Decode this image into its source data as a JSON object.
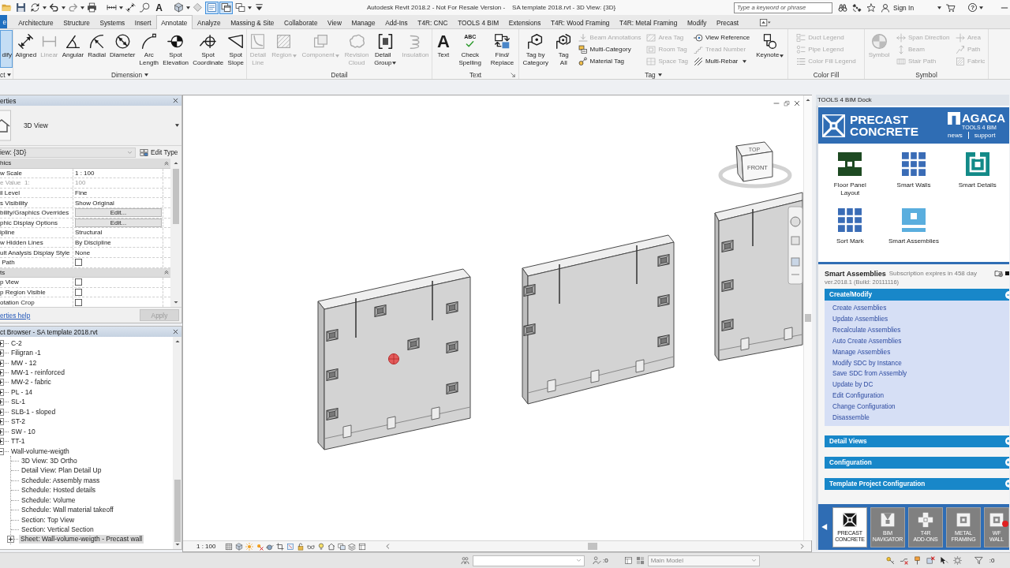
{
  "title_bar": {
    "quick_access": [
      {
        "on": false,
        "dropdown": false
      },
      {
        "on": false,
        "dropdown": false
      },
      {
        "on": false,
        "dropdown": true
      },
      {
        "on": false,
        "dropdown": true
      },
      {
        "on": false,
        "dropdown": true
      },
      {
        "on": false,
        "dropdown": false
      },
      {
        "on": false,
        "dropdown": true
      },
      {
        "on": false,
        "dropdown": false
      },
      {
        "on": false,
        "dropdown": false
      },
      {
        "on": false,
        "dropdown": false,
        "glyph": "A"
      },
      {
        "on": false,
        "dropdown": true
      },
      {
        "on": false,
        "dropdown": false
      },
      {
        "on": true,
        "dropdown": false
      },
      {
        "on": true,
        "dropdown": false
      },
      {
        "on": false,
        "dropdown": true
      },
      {
        "on": false,
        "dropdown": false
      }
    ],
    "title": "Autodesk Revit 2018.2 - Not For Resale Version -    SA template 2018.rvt - 3D View: {3D}",
    "search": {
      "placeholder": "Type a keyword or phrase"
    },
    "sign_in": "Sign In",
    "help": "?"
  },
  "ribbon": {
    "tabs": [
      {
        "label": "e",
        "kind": "file",
        "selected": false
      },
      {
        "label": "Architecture",
        "kind": "tab",
        "selected": false
      },
      {
        "label": "Structure",
        "kind": "tab",
        "selected": false
      },
      {
        "label": "Systems",
        "kind": "tab",
        "selected": false
      },
      {
        "label": "Insert",
        "kind": "tab",
        "selected": false
      },
      {
        "label": "Annotate",
        "kind": "tab",
        "selected": true
      },
      {
        "label": "Analyze",
        "kind": "tab",
        "selected": false
      },
      {
        "label": "Massing & Site",
        "kind": "tab",
        "selected": false
      },
      {
        "label": "Collaborate",
        "kind": "tab",
        "selected": false
      },
      {
        "label": "View",
        "kind": "tab",
        "selected": false
      },
      {
        "label": "Manage",
        "kind": "tab",
        "selected": false
      },
      {
        "label": "Add-Ins",
        "kind": "tab",
        "selected": false
      },
      {
        "label": "T4R: CNC",
        "kind": "tab",
        "selected": false
      },
      {
        "label": "TOOLS 4 BIM",
        "kind": "tab",
        "selected": false
      },
      {
        "label": "Extensions",
        "kind": "tab",
        "selected": false
      },
      {
        "label": "T4R: Wood Framing",
        "kind": "tab",
        "selected": false
      },
      {
        "label": "T4R: Metal Framing",
        "kind": "tab",
        "selected": false
      },
      {
        "label": "Modify",
        "kind": "tab",
        "selected": false
      },
      {
        "label": "Precast",
        "kind": "tab",
        "selected": false
      }
    ],
    "groups": [
      {
        "label": "ct",
        "menu": true,
        "launcher": false,
        "tools": [
          {
            "kind": "large",
            "label": "dify",
            "selected": true,
            "disabled": false,
            "dropdown": false
          }
        ]
      },
      {
        "label": "Dimension",
        "menu": true,
        "launcher": false,
        "tools": [
          {
            "kind": "large",
            "label": "Aligned",
            "selected": false,
            "disabled": false,
            "dropdown": false
          },
          {
            "kind": "large",
            "label": "Linear",
            "selected": false,
            "disabled": true,
            "dropdown": false
          },
          {
            "kind": "large",
            "label": "Angular",
            "selected": false,
            "disabled": false,
            "dropdown": false
          },
          {
            "kind": "large",
            "label": "Radial",
            "selected": false,
            "disabled": false,
            "dropdown": false
          },
          {
            "kind": "large",
            "label": "Diameter",
            "selected": false,
            "disabled": false,
            "dropdown": false
          },
          {
            "kind": "large",
            "label": "Arc\nLength",
            "selected": false,
            "disabled": false,
            "dropdown": false
          },
          {
            "kind": "large",
            "label": "Spot\nElevation",
            "selected": false,
            "disabled": false,
            "dropdown": false
          },
          {
            "kind": "large",
            "label": "Spot\nCoordinate",
            "selected": false,
            "disabled": false,
            "dropdown": false
          },
          {
            "kind": "large",
            "label": "Spot\nSlope",
            "selected": false,
            "disabled": false,
            "dropdown": false
          }
        ]
      },
      {
        "label": "Detail",
        "menu": false,
        "launcher": false,
        "tools": [
          {
            "kind": "large",
            "label": "Detail\nLine",
            "selected": false,
            "disabled": true,
            "dropdown": false
          },
          {
            "kind": "large",
            "label": "Region",
            "selected": false,
            "disabled": true,
            "dropdown": true
          },
          {
            "kind": "large",
            "label": "Component",
            "selected": false,
            "disabled": true,
            "dropdown": true
          },
          {
            "kind": "large",
            "label": "Revision\nCloud",
            "selected": false,
            "disabled": true,
            "dropdown": false
          },
          {
            "kind": "large",
            "label": "Detail\nGroup",
            "selected": false,
            "disabled": false,
            "dropdown": true
          },
          {
            "kind": "large",
            "label": "Insulation",
            "selected": false,
            "disabled": true,
            "dropdown": false
          }
        ]
      },
      {
        "label": "Text",
        "menu": false,
        "launcher": true,
        "tools": [
          {
            "kind": "large",
            "label": "Text",
            "glyph": "A",
            "selected": false,
            "disabled": false,
            "dropdown": false
          },
          {
            "kind": "large",
            "label": "Check\nSpelling",
            "glyph": "ABC",
            "selected": false,
            "disabled": false,
            "dropdown": false
          },
          {
            "kind": "large",
            "label": "Find/\nReplace",
            "selected": false,
            "disabled": false,
            "dropdown": false
          }
        ]
      },
      {
        "label": "Tag",
        "menu": true,
        "launcher": false,
        "tools": [
          {
            "kind": "large",
            "label": "Tag by\nCategory",
            "selected": false,
            "disabled": false,
            "dropdown": false
          },
          {
            "kind": "large",
            "label": "Tag\nAll",
            "selected": false,
            "disabled": false,
            "dropdown": false
          },
          {
            "kind": "stack",
            "items": [
              {
                "label": "Beam Annotations",
                "disabled": true,
                "dropdown": false
              },
              {
                "label": "Multi-Category",
                "disabled": false,
                "dropdown": false
              },
              {
                "label": "Material Tag",
                "disabled": false,
                "dropdown": false
              }
            ]
          },
          {
            "kind": "stack",
            "items": [
              {
                "label": "Area Tag",
                "disabled": true,
                "dropdown": false
              },
              {
                "label": "Room Tag",
                "disabled": true,
                "dropdown": false
              },
              {
                "label": "Space Tag",
                "disabled": true,
                "dropdown": false
              }
            ]
          },
          {
            "kind": "stack",
            "items": [
              {
                "label": "View Reference",
                "disabled": false,
                "dropdown": false
              },
              {
                "label": "Tread Number",
                "disabled": true,
                "dropdown": false
              },
              {
                "label": "Multi-Rebar",
                "disabled": false,
                "dropdown": true
              }
            ]
          },
          {
            "kind": "large",
            "label": "Keynote",
            "selected": false,
            "disabled": false,
            "dropdown": true
          }
        ]
      },
      {
        "label": "Color Fill",
        "menu": false,
        "launcher": false,
        "tools": [
          {
            "kind": "stack",
            "items": [
              {
                "label": "Duct Legend",
                "disabled": true,
                "dropdown": false
              },
              {
                "label": "Pipe Legend",
                "disabled": true,
                "dropdown": false
              },
              {
                "label": "Color Fill Legend",
                "disabled": true,
                "dropdown": false
              }
            ]
          }
        ]
      },
      {
        "label": "Symbol",
        "menu": false,
        "launcher": false,
        "tools": [
          {
            "kind": "large",
            "label": "Symbol",
            "selected": false,
            "disabled": true,
            "dropdown": false
          },
          {
            "kind": "stack",
            "items": [
              {
                "label": "Span Direction",
                "disabled": true,
                "dropdown": false
              },
              {
                "label": "Beam",
                "disabled": true,
                "dropdown": false
              },
              {
                "label": "Stair Path",
                "disabled": true,
                "dropdown": false
              }
            ]
          },
          {
            "kind": "stack",
            "items": [
              {
                "label": "Area",
                "disabled": true,
                "dropdown": false
              },
              {
                "label": "Path",
                "disabled": true,
                "dropdown": false
              },
              {
                "label": "Fabric",
                "disabled": true,
                "dropdown": false
              }
            ]
          }
        ]
      }
    ]
  },
  "properties": {
    "title": "erties",
    "type": "3D View",
    "filter": "iew: {3D}",
    "edit_type": "Edit Type",
    "groups": [
      {
        "label": "hics",
        "expanded": true,
        "rows": [
          {
            "name": "w Scale",
            "kind": "text",
            "value": "1 : 100",
            "disabled": false
          },
          {
            "name": "e Value  1:",
            "kind": "text",
            "value": "100",
            "disabled": true
          },
          {
            "name": "il Level",
            "kind": "text",
            "value": "Fine",
            "disabled": false
          },
          {
            "name": "s Visibility",
            "kind": "text",
            "value": "Show Original",
            "disabled": false
          },
          {
            "name": "bility/Graphics Overrides",
            "kind": "button",
            "value": "Edit...",
            "disabled": false
          },
          {
            "name": "phic Display Options",
            "kind": "button",
            "value": "Edit...",
            "disabled": false
          },
          {
            "name": "ipline",
            "kind": "text",
            "value": "Structural",
            "disabled": false
          },
          {
            "name": "w Hidden Lines",
            "kind": "text",
            "value": "By Discipline",
            "disabled": false
          },
          {
            "name": "ult Analysis Display Style",
            "kind": "text",
            "value": "None",
            "disabled": false
          },
          {
            "name": " Path",
            "kind": "checkbox",
            "checked": false,
            "disabled": false
          }
        ]
      },
      {
        "label": "ts",
        "expanded": true,
        "rows": [
          {
            "name": "p View",
            "kind": "checkbox",
            "checked": false,
            "disabled": false
          },
          {
            "name": "p Region Visible",
            "kind": "checkbox",
            "checked": false,
            "disabled": false
          },
          {
            "name": "otation Crop",
            "kind": "checkbox",
            "checked": false,
            "disabled": false
          }
        ]
      }
    ],
    "help": "erties help",
    "apply": {
      "label": "Apply",
      "disabled": true
    }
  },
  "project_browser": {
    "title": "ct Browser - SA template 2018.rvt",
    "tree": [
      {
        "label": "C-2",
        "kind": "group",
        "expanded": false,
        "selected": false
      },
      {
        "label": "Filigran -1",
        "kind": "group",
        "expanded": false,
        "selected": false
      },
      {
        "label": "MW - 12",
        "kind": "group",
        "expanded": false,
        "selected": false
      },
      {
        "label": "MW-1 - reinforced",
        "kind": "group",
        "expanded": false,
        "selected": false
      },
      {
        "label": "MW-2 - fabric",
        "kind": "group",
        "expanded": false,
        "selected": false
      },
      {
        "label": "PL - 14",
        "kind": "group",
        "expanded": false,
        "selected": false
      },
      {
        "label": "SL-1",
        "kind": "group",
        "expanded": false,
        "selected": false
      },
      {
        "label": "SLB-1 - sloped",
        "kind": "group",
        "expanded": false,
        "selected": false
      },
      {
        "label": "ST-2",
        "kind": "group",
        "expanded": false,
        "selected": false
      },
      {
        "label": "SW - 10",
        "kind": "group",
        "expanded": false,
        "selected": false
      },
      {
        "label": "TT-1",
        "kind": "group",
        "expanded": false,
        "selected": false
      },
      {
        "label": "Wall-volume-weigth",
        "kind": "group",
        "expanded": true,
        "selected": false,
        "children": [
          {
            "label": "3D View: 3D Ortho",
            "kind": "view",
            "selected": false
          },
          {
            "label": "Detail View: Plan Detail Up",
            "kind": "view",
            "selected": false
          },
          {
            "label": "Schedule: Assembly mass",
            "kind": "view",
            "selected": false
          },
          {
            "label": "Schedule: Hosted details",
            "kind": "view",
            "selected": false
          },
          {
            "label": "Schedule: Volume",
            "kind": "view",
            "selected": false
          },
          {
            "label": "Schedule: Wall material takeoff",
            "kind": "view",
            "selected": false
          },
          {
            "label": "Section: Top View",
            "kind": "view",
            "selected": false
          },
          {
            "label": "Section: Vertical Section",
            "kind": "view",
            "selected": false
          },
          {
            "label": "Sheet: Wall-volume-weigth - Precast wall",
            "kind": "group",
            "expanded": false,
            "selected": true
          }
        ]
      }
    ]
  },
  "view": {
    "viewcube": {
      "top": "TOP",
      "front": "FRONT"
    },
    "scale": "1 : 100"
  },
  "dock": {
    "title": "TOOLS 4 BIM Dock",
    "banner": {
      "product": "PRECAST\nCONCRETE",
      "brand": "AGACA",
      "tagline": "TOOLS 4 BIM",
      "links": [
        "news",
        "support"
      ]
    },
    "tools": [
      {
        "label": "Floor Panel\nLayout",
        "color": "#1e4a22"
      },
      {
        "label": "Smart Walls",
        "color": "#3a6cb6"
      },
      {
        "label": "Smart Details",
        "color": "#138a88"
      },
      {
        "label": "Sort Mark",
        "color": "#3a6cb6"
      },
      {
        "label": "Smart Assemblies",
        "color": "#5aaede"
      }
    ],
    "panel": {
      "title": "Smart Assemblies",
      "subscription": "Subscription expires in 458 day",
      "version": "ver.2018.1 (Build: 20111116)",
      "sections": [
        {
          "label": "Create/Modify",
          "expanded": true,
          "items": [
            "Create Assemblies",
            "Update Assemblies",
            "Recalculate Assemblies",
            "Auto Create Assemblies",
            "Manage Assemblies",
            "Modify SDC by Instance",
            "Save SDC from Assembly",
            "Update by DC",
            "Edit Configuration",
            "Change Configuration",
            "Disassemble"
          ]
        },
        {
          "label": "Detail Views",
          "expanded": false
        },
        {
          "label": "Configuration",
          "expanded": false
        },
        {
          "label": "Template Project Configuration",
          "expanded": false
        }
      ]
    },
    "tabs": [
      {
        "label": "PRECAST\nCONCRETE",
        "selected": true,
        "badge": false
      },
      {
        "label": "BIM\nNAVIGATOR",
        "selected": false,
        "badge": false
      },
      {
        "label": "T4R\nADD-ONS",
        "selected": false,
        "badge": false
      },
      {
        "label": "METAL\nFRAMING",
        "selected": false,
        "badge": false
      },
      {
        "label": "WF\nWALL",
        "selected": false,
        "badge": true
      }
    ]
  },
  "status_bar": {
    "selection_count": ":0",
    "design_option": {
      "value": "Main Model",
      "disabled": true
    },
    "filter_count": ":0"
  }
}
